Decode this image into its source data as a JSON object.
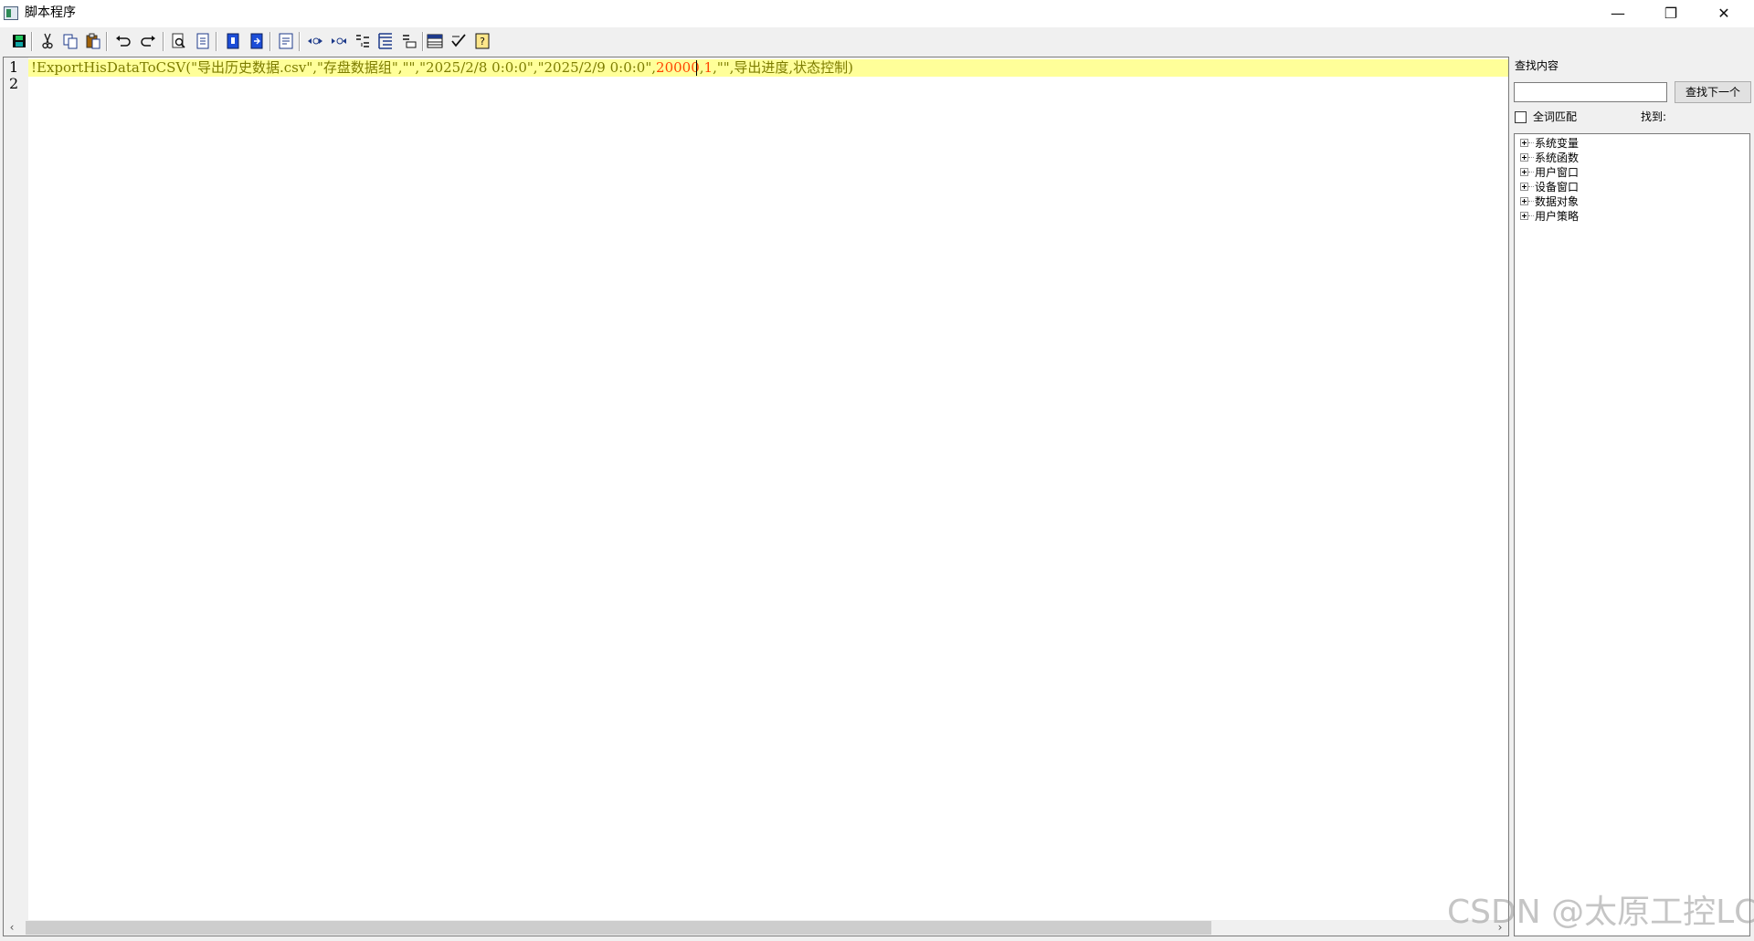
{
  "window": {
    "title": "脚本程序",
    "controls": {
      "minimize": "—",
      "maximize": "❐",
      "close": "✕"
    }
  },
  "toolbar": {
    "buttons": [
      "save-icon",
      "cut-icon",
      "copy-icon",
      "paste-icon",
      "undo-icon",
      "redo-icon",
      "find-icon",
      "replace-icon",
      "bookmark-icon",
      "bookmark-next-icon",
      "comment-icon",
      "indent-icon",
      "outdent-icon",
      "list-icon",
      "tree-list-icon",
      "align-icon",
      "table-icon",
      "check-icon",
      "help-icon"
    ]
  },
  "editor": {
    "line_numbers": [
      "1",
      "2"
    ],
    "line1": {
      "part1": "!ExportHisDataToCSV(\"导出历史数据.csv\",\"存盘数据组\",\"\",\"2025/2/8 0:0:0\",\"2025/2/9 0:0:0\",",
      "num1": "20000",
      "sep": ",",
      "num2": "1",
      "part2": ",\"\",导出进度,状态控制)"
    },
    "scroll_left": "‹",
    "scroll_right": "›",
    "colors": {
      "highlight": "#ffff99",
      "text": "#7d7d00",
      "number": "#ff4500"
    }
  },
  "sidebar": {
    "find_label": "查找内容",
    "find_input_value": "",
    "find_next_label": "查找下一个",
    "whole_word_label": "全词匹配",
    "whole_word_checked": false,
    "found_label": "找到:",
    "tree": [
      "系统变量",
      "系统函数",
      "用户窗口",
      "设备窗口",
      "数据对象",
      "用户策略"
    ]
  },
  "watermark": "CSDN @太原工控LC"
}
